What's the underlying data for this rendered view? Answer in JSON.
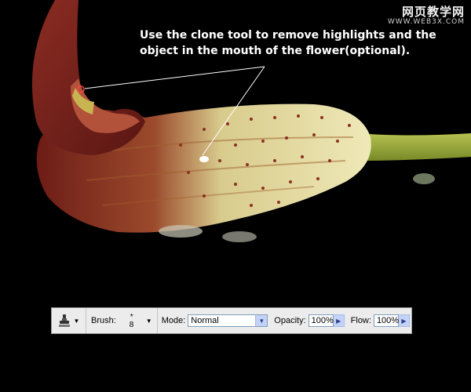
{
  "watermark": {
    "site_name": "网页教学网",
    "url": "WWW.WEB3X.COM"
  },
  "annotation": {
    "line1": "Use the clone tool to remove highlights and the",
    "line2": "object in the mouth of the flower(optional)."
  },
  "toolbar": {
    "tool_icon": "clone-stamp-icon",
    "brush_label": "Brush:",
    "brush_size": "8",
    "mode_label": "Mode:",
    "mode_value": "Normal",
    "opacity_label": "Opacity:",
    "opacity_value": "100%",
    "flow_label": "Flow:",
    "flow_value": "100%"
  },
  "colors": {
    "background": "#000000",
    "petal_dark": "#6e1f1a",
    "petal_cream": "#e9e2a4",
    "stem": "#98a83c",
    "toolbar_bg": "#ececec",
    "select_button": "#c3d3f7"
  }
}
